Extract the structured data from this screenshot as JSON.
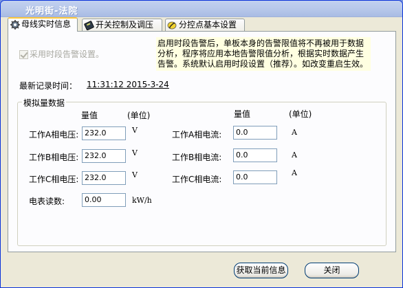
{
  "window": {
    "title": "光明街-法院"
  },
  "tabs": [
    {
      "label": "母线实时信息",
      "icon": "gear-icon"
    },
    {
      "label": "开关控制及调压",
      "icon": "switch-icon"
    },
    {
      "label": "分控点基本设置",
      "icon": "config-icon"
    }
  ],
  "alarm": {
    "checkbox_label": "采用时段告警设置。",
    "checked": true,
    "notice": "启用时段告警后，单板本身的告警限值将不再被用于数据分析，程序将应用本地告警限值分析，根据实时数据产生告警。系统默认启用时段设置（推荐）。如改变重启生效。"
  },
  "record": {
    "label": "最新记录时间：",
    "value": "11:31:12   2015-3-24"
  },
  "analog": {
    "group_title": "模拟量数据",
    "col_value": "量值",
    "col_unit": "(单位)",
    "voltage": [
      {
        "label": "工作A相电压:",
        "value": "232.0",
        "unit": "V"
      },
      {
        "label": "工作B相电压:",
        "value": "232.0",
        "unit": "V"
      },
      {
        "label": "工作C相电压:",
        "value": "232.0",
        "unit": "V"
      }
    ],
    "current": [
      {
        "label": "工作A相电流:",
        "value": "0.0",
        "unit": "A"
      },
      {
        "label": "工作B相电流:",
        "value": "0.0",
        "unit": "A"
      },
      {
        "label": "工作C相电流:",
        "value": "0.0",
        "unit": "A"
      }
    ],
    "meter": {
      "label": "电表读数:",
      "value": "0.00",
      "unit": "kW/h"
    }
  },
  "buttons": {
    "refresh": "获取当前信息",
    "close": "关闭"
  }
}
